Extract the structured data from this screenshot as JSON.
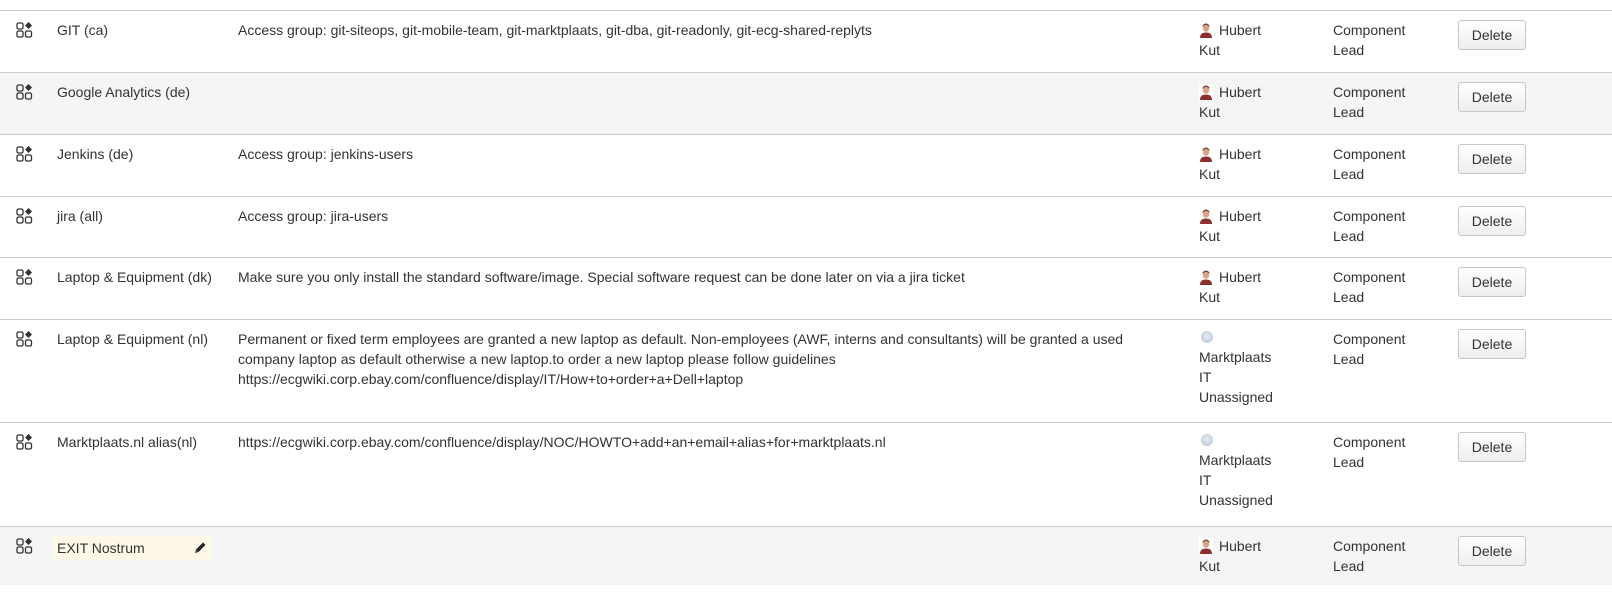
{
  "rows": [
    {
      "name": "GIT (ca)",
      "description": "Access group: git-siteops, git-mobile-team, git-marktplaats, git-dba, git-readonly, git-ecg-shared-replyts",
      "lead": [
        "Hubert",
        "Kut"
      ],
      "lead_avatar": "user-photo-icon",
      "assignee_type": [
        "Component",
        "Lead"
      ],
      "action": "Delete"
    },
    {
      "name": "Google Analytics (de)",
      "description": "",
      "lead": [
        "Hubert",
        "Kut"
      ],
      "lead_avatar": "user-photo-icon",
      "assignee_type": [
        "Component",
        "Lead"
      ],
      "action": "Delete"
    },
    {
      "name": "Jenkins (de)",
      "description": "Access group: jenkins-users",
      "lead": [
        "Hubert",
        "Kut"
      ],
      "lead_avatar": "user-photo-icon",
      "assignee_type": [
        "Component",
        "Lead"
      ],
      "action": "Delete"
    },
    {
      "name": "jira (all)",
      "description": "Access group: jira-users",
      "lead": [
        "Hubert",
        "Kut"
      ],
      "lead_avatar": "user-photo-icon",
      "assignee_type": [
        "Component",
        "Lead"
      ],
      "action": "Delete"
    },
    {
      "name": "Laptop & Equipment (dk)",
      "description": "Make sure you only install the standard software/image. Special software request can be done later on via a jira ticket",
      "lead": [
        "Hubert",
        "Kut"
      ],
      "lead_avatar": "user-photo-icon",
      "assignee_type": [
        "Component",
        "Lead"
      ],
      "action": "Delete"
    },
    {
      "name": "Laptop & Equipment (nl)",
      "description": "Permanent or fixed term employees are granted a new laptop as default. Non-employees (AWF, interns and consultants) will be granted a used company laptop as default otherwise a new laptop.to order a new laptop please follow guidelines https://ecgwiki.corp.ebay.com/confluence/display/IT/How+to+order+a+Dell+laptop",
      "lead": [
        "Marktplaats",
        "IT",
        "Unassigned"
      ],
      "lead_avatar": "default-avatar-icon",
      "assignee_type": [
        "Component",
        "Lead"
      ],
      "action": "Delete"
    },
    {
      "name": "Marktplaats.nl alias(nl)",
      "description": "https://ecgwiki.corp.ebay.com/confluence/display/NOC/HOWTO+add+an+email+alias+for+marktplaats.nl",
      "lead": [
        "Marktplaats",
        "IT",
        "Unassigned"
      ],
      "lead_avatar": "default-avatar-icon",
      "assignee_type": [
        "Component",
        "Lead"
      ],
      "action": "Delete"
    },
    {
      "name": "EXIT Nostrum",
      "description": "",
      "lead": [
        "Hubert",
        "Kut"
      ],
      "lead_avatar": "user-photo-icon",
      "assignee_type": [
        "Component",
        "Lead"
      ],
      "action": "Delete",
      "editing": true
    }
  ],
  "colors": {
    "row_alt": "#f5f5f5",
    "edit_highlight": "#fdf8e7",
    "divider": "#cccccc",
    "text": "#333333"
  }
}
